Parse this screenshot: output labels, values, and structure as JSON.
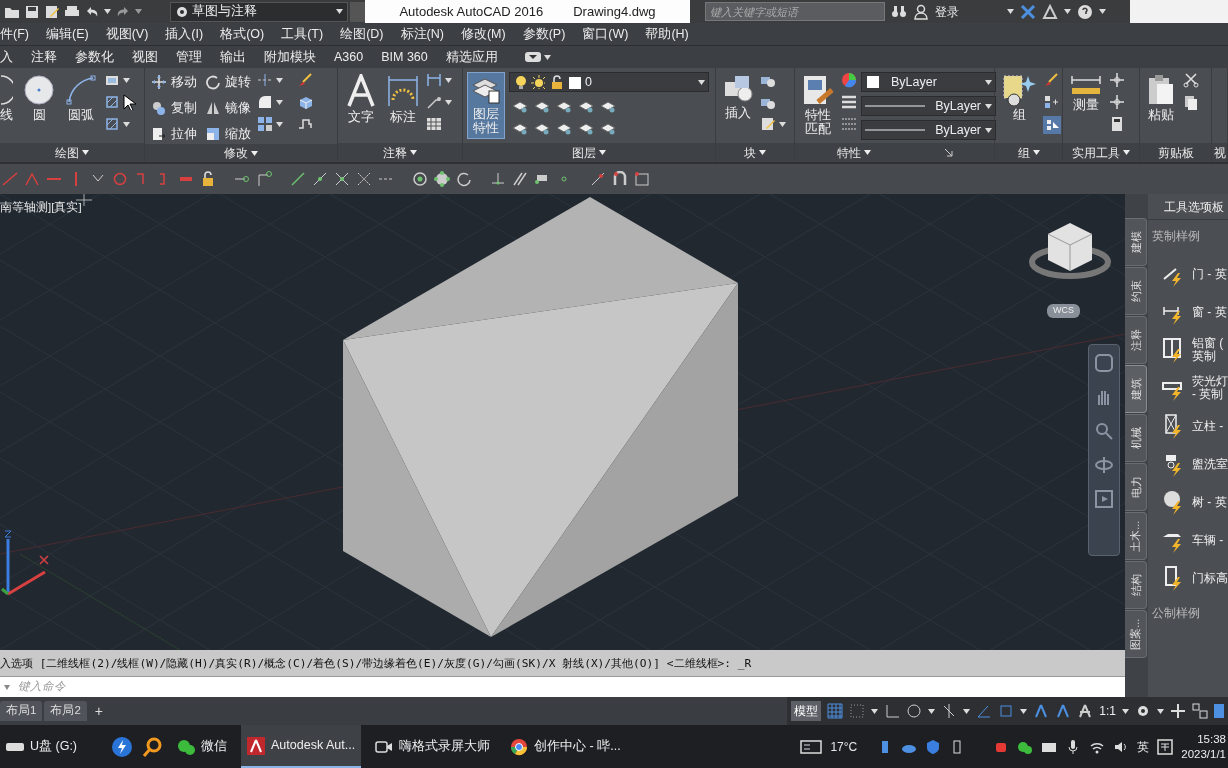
{
  "title_bar": {
    "workspace": "草图与注释",
    "app_title": "Autodesk AutoCAD 2016",
    "file_name": "Drawing4.dwg",
    "search_placeholder": "键入关键字或短语",
    "login": "登录"
  },
  "menu": [
    "件(F)",
    "编辑(E)",
    "视图(V)",
    "插入(I)",
    "格式(O)",
    "工具(T)",
    "绘图(D)",
    "标注(N)",
    "修改(M)",
    "参数(P)",
    "窗口(W)",
    "帮助(H)"
  ],
  "ribbon_tabs": [
    "入",
    "注释",
    "参数化",
    "视图",
    "管理",
    "输出",
    "附加模块",
    "A360",
    "BIM 360",
    "精选应用"
  ],
  "panels": [
    {
      "kind": "draw",
      "title": "绘图",
      "tools": [
        "线",
        "圆",
        "圆弧"
      ]
    },
    {
      "kind": "modify",
      "title": "修改",
      "tools": [
        "移动",
        "旋转",
        "复制",
        "镜像",
        "拉伸",
        "缩放"
      ]
    },
    {
      "kind": "annotate",
      "title": "注释",
      "tools": [
        "文字",
        "标注"
      ]
    },
    {
      "kind": "layers",
      "title": "图层",
      "tools": [
        "图层特性"
      ],
      "selected": true,
      "layer": "0"
    },
    {
      "kind": "block",
      "title": "块",
      "tools": [
        "插入"
      ]
    },
    {
      "kind": "properties",
      "title": "特性",
      "tools": [
        "特性匹配"
      ],
      "dropdowns": [
        "ByLayer",
        "ByLayer",
        "ByLayer"
      ]
    },
    {
      "kind": "group",
      "title": "组",
      "tools": [
        "组"
      ]
    },
    {
      "kind": "utilities",
      "title": "实用工具",
      "tools": [
        "测量"
      ]
    },
    {
      "kind": "clipboard",
      "title": "剪贴板",
      "tools": [
        "粘贴"
      ]
    },
    {
      "kind": "cut",
      "title": "视"
    }
  ],
  "viewport": {
    "label": "南等轴测][真实]",
    "wcs": "WCS"
  },
  "palette": {
    "title": "工具选项板",
    "tabs": [
      {
        "label": "建模",
        "selected": false
      },
      {
        "label": "约束",
        "selected": false
      },
      {
        "label": "注释",
        "selected": false
      },
      {
        "label": "建筑",
        "selected": true
      },
      {
        "label": "机械",
        "selected": false
      },
      {
        "label": "电力",
        "selected": false
      },
      {
        "label": "土木...",
        "selected": false
      },
      {
        "label": "结构",
        "selected": false
      },
      {
        "label": "图案...",
        "selected": false
      }
    ],
    "sections": [
      {
        "title": "英制样例",
        "items": [
          {
            "lines": [
              "门 - 英"
            ]
          },
          {
            "lines": [
              "窗 - 英"
            ]
          },
          {
            "lines": [
              "铝窗 (",
              "英制"
            ]
          },
          {
            "lines": [
              "荧光灯",
              "- 英制"
            ]
          },
          {
            "lines": [
              "立柱 -"
            ]
          },
          {
            "lines": [
              "盥洗室"
            ]
          },
          {
            "lines": [
              "树 - 英"
            ]
          },
          {
            "lines": [
              "车辆 -"
            ]
          },
          {
            "lines": [
              "门标高"
            ]
          }
        ]
      },
      {
        "title": "公制样例"
      }
    ]
  },
  "command": {
    "history": "入选项 [二维线框(2)/线框(W)/隐藏(H)/真实(R)/概念(C)/着色(S)/带边缘着色(E)/灰度(G)/勾画(SK)/X 射线(X)/其他(O)] <二维线框>: _R",
    "placeholder": "键入命令"
  },
  "layout_tabs": [
    {
      "label": "布局1",
      "selected": false
    },
    {
      "label": "布局2",
      "selected": false
    }
  ],
  "add_tab": "+",
  "status_bar": {
    "model": "模型",
    "scale": "1:1"
  },
  "taskbar": {
    "items": [
      {
        "label": "U盘 (G:)",
        "selected": false
      },
      {
        "label": "微信",
        "selected": false
      },
      {
        "label": "Autodesk Aut...",
        "selected": true
      },
      {
        "label": "嗨格式录屏大师",
        "selected": false
      },
      {
        "label": "创作中心 - 哔...",
        "selected": false
      }
    ],
    "weather": "17°C",
    "ime": "英",
    "time": "15:38",
    "date": "2023/1/1"
  }
}
